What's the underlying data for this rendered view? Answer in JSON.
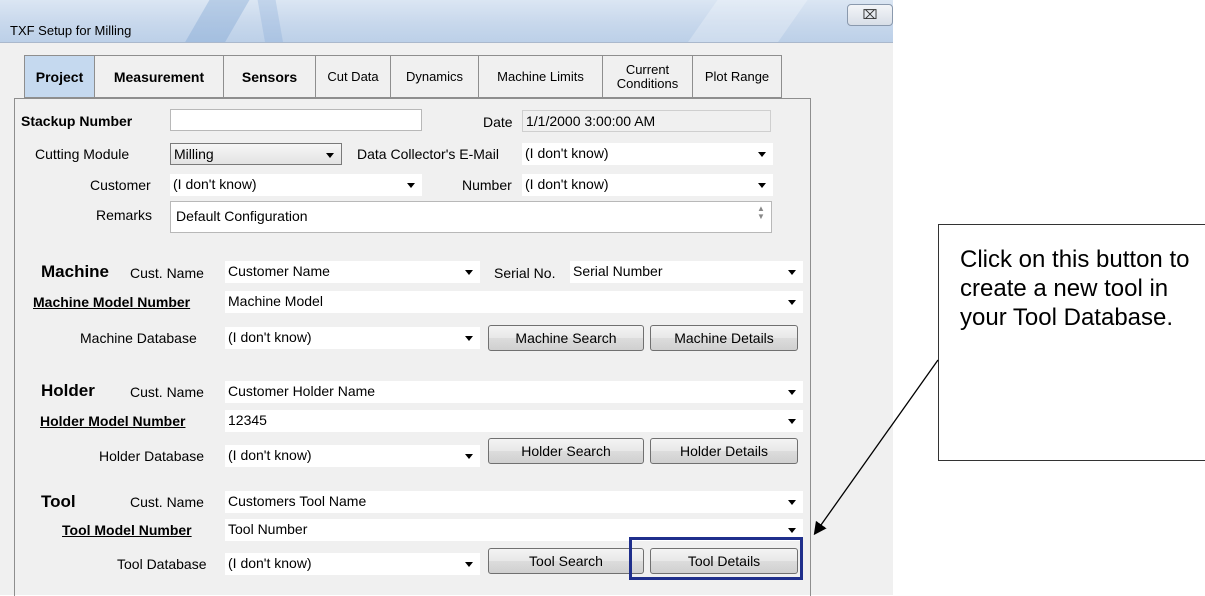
{
  "window": {
    "title": "TXF Setup for Milling",
    "close_label": "⌧"
  },
  "tabs": [
    {
      "label": "Project"
    },
    {
      "label": "Measurement"
    },
    {
      "label": "Sensors"
    },
    {
      "label": "Cut Data"
    },
    {
      "label": "Dynamics"
    },
    {
      "label": "Machine Limits"
    },
    {
      "label": "Current Conditions"
    },
    {
      "label": "Plot Range"
    }
  ],
  "project": {
    "stackup_label": "Stackup Number",
    "stackup_value": "",
    "date_label": "Date",
    "date_value": "1/1/2000 3:00:00 AM",
    "cutting_module_label": "Cutting Module",
    "cutting_module_value": "Milling",
    "email_label": "Data Collector's E-Mail",
    "email_value": "(I don't know)",
    "customer_label": "Customer",
    "customer_value": "(I don't know)",
    "number_label": "Number",
    "number_value": "(I don't know)",
    "remarks_label": "Remarks",
    "remarks_value": "Default Configuration"
  },
  "machine": {
    "header": "Machine",
    "cust_name_label": "Cust. Name",
    "cust_name_value": "Customer Name",
    "serial_label": "Serial No.",
    "serial_value": "Serial Number",
    "model_label": "Machine Model Number",
    "model_value": "Machine Model",
    "db_label": "Machine Database",
    "db_value": "(I don't know)",
    "search_button": "Machine Search",
    "details_button": "Machine Details"
  },
  "holder": {
    "header": "Holder",
    "cust_name_label": "Cust. Name",
    "cust_name_value": "Customer Holder Name",
    "model_label": "Holder Model Number",
    "model_value": "12345",
    "db_label": "Holder Database",
    "db_value": "(I don't know)",
    "search_button": "Holder Search",
    "details_button": "Holder Details"
  },
  "tool": {
    "header": "Tool",
    "cust_name_label": "Cust. Name",
    "cust_name_value": "Customers Tool Name",
    "model_label": "Tool Model Number",
    "model_value": "Tool Number",
    "db_label": "Tool Database",
    "db_value": "(I don't know)",
    "search_button": "Tool Search",
    "details_button": "Tool Details"
  },
  "callout": {
    "text": "Click on this button to create a new tool in your Tool Database."
  },
  "colors": {
    "active_tab": "#c5d9ef",
    "highlight": "#1f2f8c"
  }
}
